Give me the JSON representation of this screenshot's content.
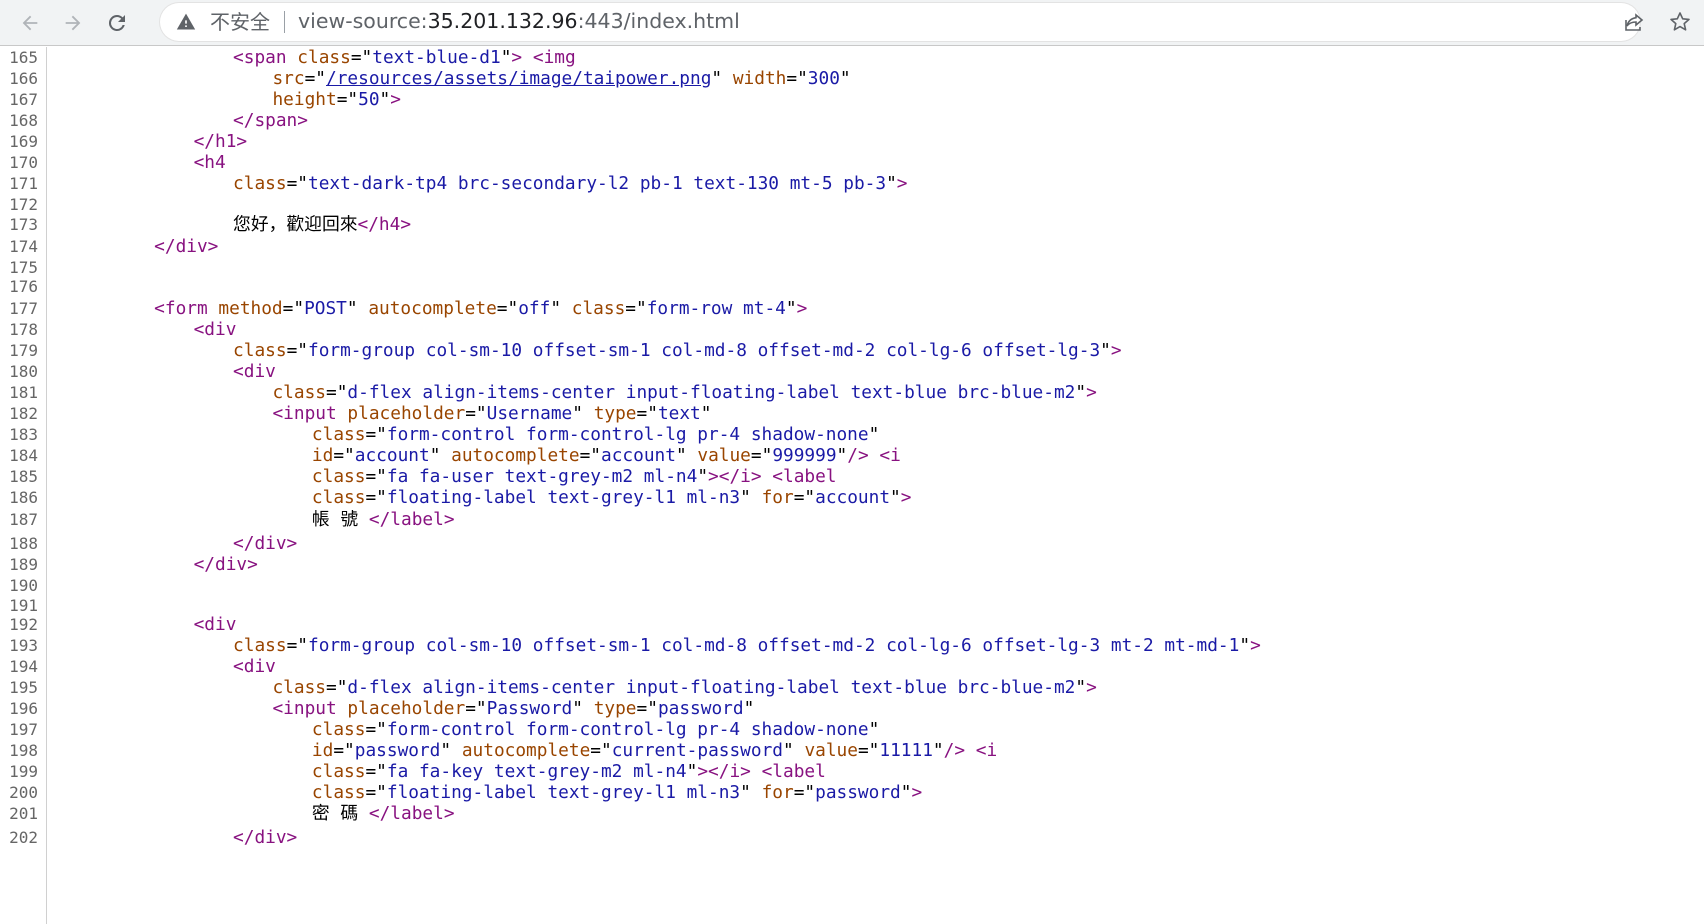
{
  "browser": {
    "security_label": "不安全",
    "url_prefix": "view-source:",
    "url_host": "35.201.132.96",
    "url_rest": ":443/index.html"
  },
  "source_lines": [
    {
      "n": "165",
      "html": "<span class='t'>&lt;span</span> <span class='a'>class</span>=\"<span class='v'>text-blue-d1</span>\"<span class='t'>&gt;</span> <span class='t'>&lt;img</span>",
      "indent": 14
    },
    {
      "n": "166",
      "html": "<span class='a'>src</span>=\"<span class='lk'>/resources/assets/image/taipower.png</span>\" <span class='a'>width</span>=\"<span class='v'>300</span>\"",
      "indent": 18
    },
    {
      "n": "167",
      "html": "<span class='a'>height</span>=\"<span class='v'>50</span>\"<span class='t'>&gt;</span>",
      "indent": 18
    },
    {
      "n": "168",
      "html": "<span class='t'>&lt;/span&gt;</span>",
      "indent": 14
    },
    {
      "n": "169",
      "html": "<span class='t'>&lt;/h1&gt;</span>",
      "indent": 10
    },
    {
      "n": "170",
      "html": "<span class='t'>&lt;h4</span>",
      "indent": 10
    },
    {
      "n": "171",
      "html": "<span class='a'>class</span>=\"<span class='v'>text-dark-tp4 brc-secondary-l2 pb-1 text-130 mt-5 pb-3</span>\"<span class='t'>&gt;</span>",
      "indent": 14
    },
    {
      "n": "172",
      "html": "",
      "indent": 0
    },
    {
      "n": "173",
      "html": "<span class='txt'>您好，歡迎回來</span><span class='t'>&lt;/h4&gt;</span>",
      "indent": 14
    },
    {
      "n": "174",
      "html": "<span class='t'>&lt;/div&gt;</span>",
      "indent": 6
    },
    {
      "n": "175",
      "html": "",
      "indent": 0
    },
    {
      "n": "176",
      "html": "",
      "indent": 0
    },
    {
      "n": "177",
      "html": "<span class='t'>&lt;form</span> <span class='a'>method</span>=\"<span class='v'>POST</span>\" <span class='a'>autocomplete</span>=\"<span class='v'>off</span>\" <span class='a'>class</span>=\"<span class='v'>form-row mt-4</span>\"<span class='t'>&gt;</span>",
      "indent": 6
    },
    {
      "n": "178",
      "html": "<span class='t'>&lt;div</span>",
      "indent": 10
    },
    {
      "n": "179",
      "html": "<span class='a'>class</span>=\"<span class='v'>form-group col-sm-10 offset-sm-1 col-md-8 offset-md-2 col-lg-6 offset-lg-3</span>\"<span class='t'>&gt;</span>",
      "indent": 14
    },
    {
      "n": "180",
      "html": "<span class='t'>&lt;div</span>",
      "indent": 14
    },
    {
      "n": "181",
      "html": "<span class='a'>class</span>=\"<span class='v'>d-flex align-items-center input-floating-label text-blue brc-blue-m2</span>\"<span class='t'>&gt;</span>",
      "indent": 18
    },
    {
      "n": "182",
      "html": "<span class='t'>&lt;input</span> <span class='a'>placeholder</span>=\"<span class='v'>Username</span>\" <span class='a'>type</span>=\"<span class='v'>text</span>\"",
      "indent": 18
    },
    {
      "n": "183",
      "html": "<span class='a'>class</span>=\"<span class='v'>form-control form-control-lg pr-4 shadow-none</span>\"",
      "indent": 22
    },
    {
      "n": "184",
      "html": "<span class='a'>id</span>=\"<span class='v'>account</span>\" <span class='a'>autocomplete</span>=\"<span class='v'>account</span>\" <span class='a'>value</span>=\"<span class='v'>999999</span>\"<span class='t'>/&gt;</span> <span class='t'>&lt;i</span>",
      "indent": 22
    },
    {
      "n": "185",
      "html": "<span class='a'>class</span>=\"<span class='v'>fa fa-user text-grey-m2 ml-n4</span>\"<span class='t'>&gt;&lt;/i&gt;</span> <span class='t'>&lt;label</span>",
      "indent": 22
    },
    {
      "n": "186",
      "html": "<span class='a'>class</span>=\"<span class='v'>floating-label text-grey-l1 ml-n3</span>\" <span class='a'>for</span>=\"<span class='v'>account</span>\"<span class='t'>&gt;</span>",
      "indent": 22
    },
    {
      "n": "187",
      "html": "<span class='txt'>帳 號 </span><span class='t'>&lt;/label&gt;</span>",
      "indent": 22
    },
    {
      "n": "188",
      "html": "<span class='t'>&lt;/div&gt;</span>",
      "indent": 14
    },
    {
      "n": "189",
      "html": "<span class='t'>&lt;/div&gt;</span>",
      "indent": 10
    },
    {
      "n": "190",
      "html": "",
      "indent": 0
    },
    {
      "n": "191",
      "html": "",
      "indent": 0
    },
    {
      "n": "192",
      "html": "<span class='t'>&lt;div</span>",
      "indent": 10
    },
    {
      "n": "193",
      "html": "<span class='a'>class</span>=\"<span class='v'>form-group col-sm-10 offset-sm-1 col-md-8 offset-md-2 col-lg-6 offset-lg-3 mt-2 mt-md-1</span>\"<span class='t'>&gt;</span>",
      "indent": 14
    },
    {
      "n": "194",
      "html": "<span class='t'>&lt;div</span>",
      "indent": 14
    },
    {
      "n": "195",
      "html": "<span class='a'>class</span>=\"<span class='v'>d-flex align-items-center input-floating-label text-blue brc-blue-m2</span>\"<span class='t'>&gt;</span>",
      "indent": 18
    },
    {
      "n": "196",
      "html": "<span class='t'>&lt;input</span> <span class='a'>placeholder</span>=\"<span class='v'>Password</span>\" <span class='a'>type</span>=\"<span class='v'>password</span>\"",
      "indent": 18
    },
    {
      "n": "197",
      "html": "<span class='a'>class</span>=\"<span class='v'>form-control form-control-lg pr-4 shadow-none</span>\"",
      "indent": 22
    },
    {
      "n": "198",
      "html": "<span class='a'>id</span>=\"<span class='v'>password</span>\" <span class='a'>autocomplete</span>=\"<span class='v'>current-password</span>\" <span class='a'>value</span>=\"<span class='v'>11111</span>\"<span class='t'>/&gt;</span> <span class='t'>&lt;i</span>",
      "indent": 22
    },
    {
      "n": "199",
      "html": "<span class='a'>class</span>=\"<span class='v'>fa fa-key text-grey-m2 ml-n4</span>\"<span class='t'>&gt;&lt;/i&gt;</span> <span class='t'>&lt;label</span>",
      "indent": 22
    },
    {
      "n": "200",
      "html": "<span class='a'>class</span>=\"<span class='v'>floating-label text-grey-l1 ml-n3</span>\" <span class='a'>for</span>=\"<span class='v'>password</span>\"<span class='t'>&gt;</span>",
      "indent": 22
    },
    {
      "n": "201",
      "html": "<span class='txt'>密 碼 </span><span class='t'>&lt;/label&gt;</span>",
      "indent": 22
    },
    {
      "n": "202",
      "html": "<span class='t'>&lt;/div&gt;</span>",
      "indent": 14
    }
  ]
}
